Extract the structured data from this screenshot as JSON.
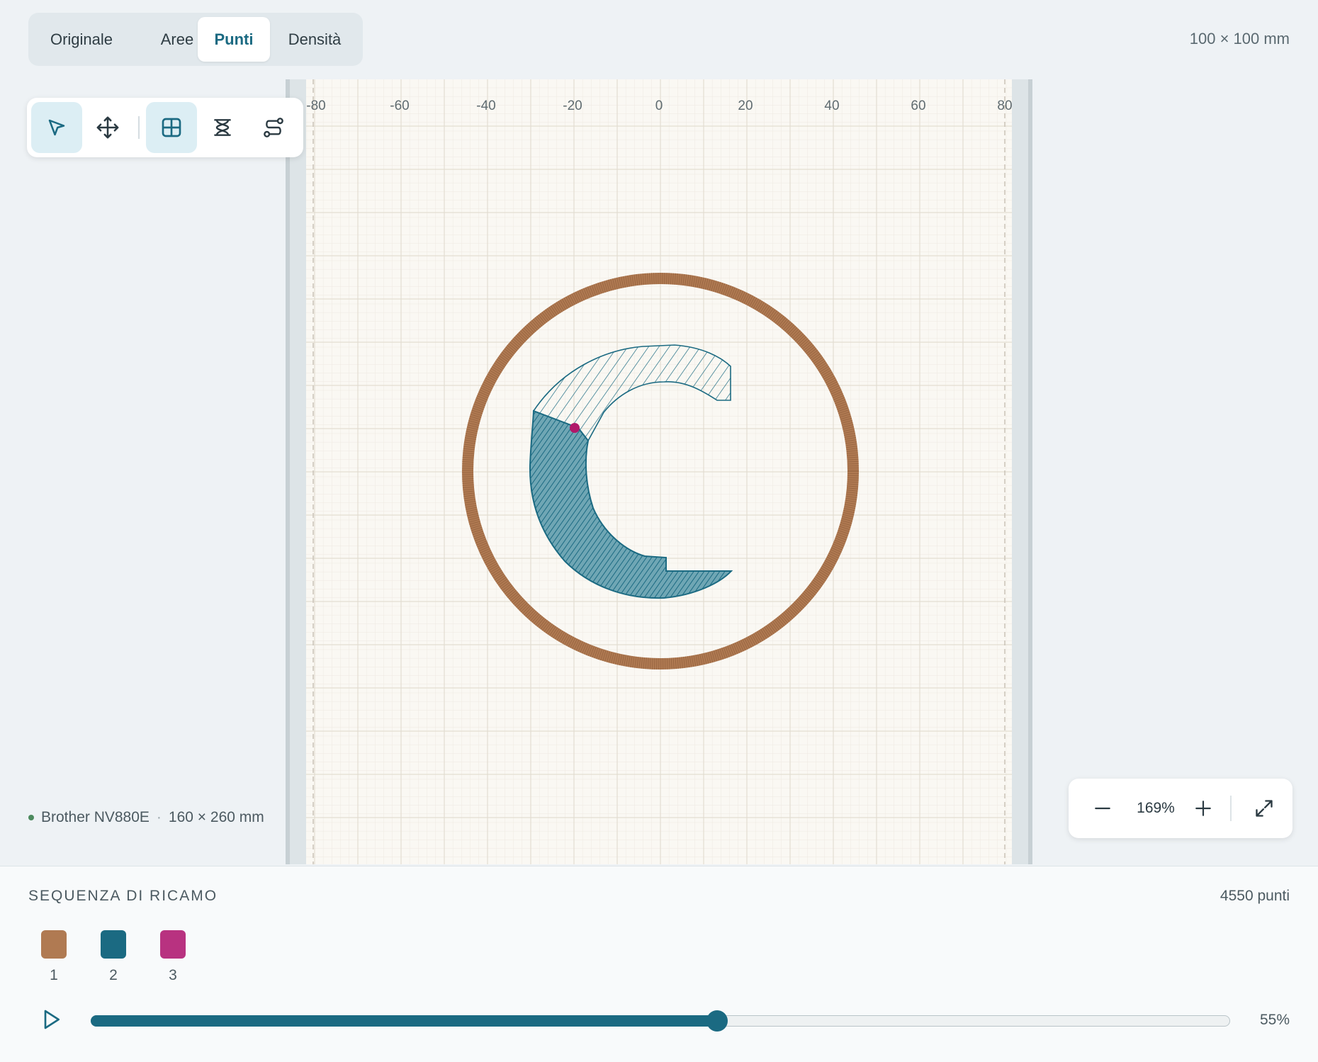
{
  "tabs": [
    {
      "label": "Originale",
      "active": false
    },
    {
      "label": "Aree",
      "active": false
    },
    {
      "label": "Punti",
      "active": true
    },
    {
      "label": "Densità",
      "active": false
    }
  ],
  "design_size": "100 × 100 mm",
  "tools": [
    {
      "icon": "pointer-icon",
      "active": true
    },
    {
      "icon": "move-icon",
      "active": false
    },
    {
      "icon": "grid-icon",
      "active": true
    },
    {
      "icon": "satin-icon",
      "active": false
    },
    {
      "icon": "path-icon",
      "active": false
    }
  ],
  "ruler_labels": [
    "-80",
    "-60",
    "-40",
    "-20",
    "0",
    "20",
    "40",
    "60",
    "80"
  ],
  "machine": {
    "name": "Brother NV880E",
    "separator": "·",
    "hoop": "160 × 260 mm"
  },
  "zoom": {
    "value": "169%"
  },
  "sequence": {
    "title": "SEQUENZA DI RICAMO",
    "count": "4550 punti",
    "colors": [
      {
        "number": "1",
        "color": "#b07a52"
      },
      {
        "number": "2",
        "color": "#1b6a82"
      },
      {
        "number": "3",
        "color": "#b83280"
      }
    ]
  },
  "playback": {
    "progress": 0.55,
    "progress_label": "55%"
  },
  "colors": {
    "accent": "#1b6a82",
    "thread_1": "#b07a52",
    "thread_2": "#1b6a82",
    "needle_marker": "#b0186a"
  }
}
